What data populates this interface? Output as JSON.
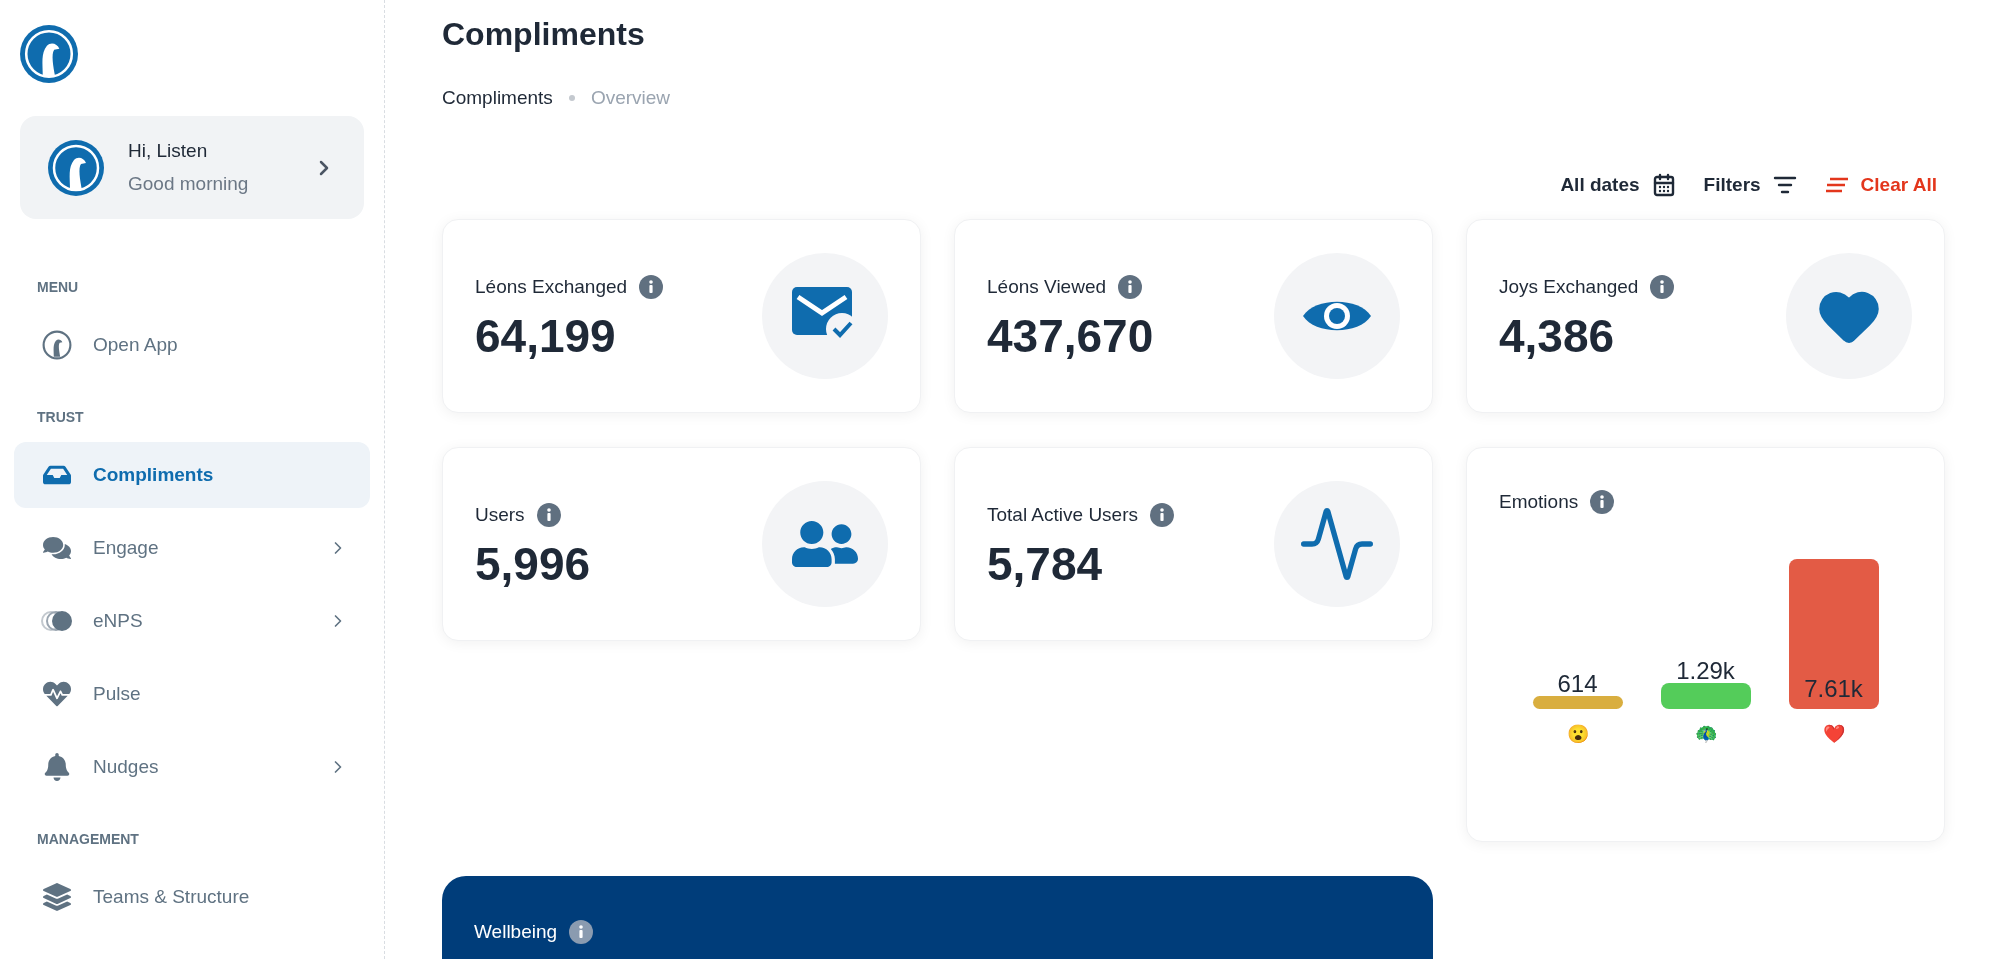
{
  "sidebar": {
    "profile": {
      "title": "Hi, Listen",
      "subtitle": "Good morning"
    },
    "sections": [
      {
        "heading": "MENU",
        "items": [
          {
            "label": "Open App",
            "kind": "bird",
            "selected": false,
            "expandable": false
          }
        ]
      },
      {
        "heading": "TRUST",
        "items": [
          {
            "label": "Compliments",
            "kind": "inbox",
            "selected": true,
            "expandable": false
          },
          {
            "label": "Engage",
            "kind": "chat",
            "selected": false,
            "expandable": true
          },
          {
            "label": "eNPS",
            "kind": "circles",
            "selected": false,
            "expandable": true
          },
          {
            "label": "Pulse",
            "kind": "heartbeat",
            "selected": false,
            "expandable": false
          },
          {
            "label": "Nudges",
            "kind": "bell",
            "selected": false,
            "expandable": true
          }
        ]
      },
      {
        "heading": "MANAGEMENT",
        "items": [
          {
            "label": "Teams & Structure",
            "kind": "layers",
            "selected": false,
            "expandable": false
          }
        ]
      }
    ]
  },
  "page": {
    "title": "Compliments",
    "breadcrumb": [
      {
        "label": "Compliments",
        "selected": true
      },
      {
        "label": "Overview",
        "selected": false
      }
    ]
  },
  "filters": [
    {
      "label": "All dates",
      "kind": "date"
    },
    {
      "label": "Filters",
      "kind": "filter"
    },
    {
      "label": "Clear All",
      "kind": "clear"
    }
  ],
  "stats": [
    {
      "label": "Léons Exchanged",
      "value": "64,199",
      "kind": "mail"
    },
    {
      "label": "Léons Viewed",
      "value": "437,670",
      "kind": "eye"
    },
    {
      "label": "Joys Exchanged",
      "value": "4,386",
      "kind": "heart"
    },
    {
      "label": "Users",
      "value": "5,996",
      "kind": "users"
    },
    {
      "label": "Total Active Users",
      "value": "5,784",
      "kind": "activity"
    }
  ],
  "emotions": {
    "title": "Emotions",
    "chart_data": {
      "type": "bar",
      "categories": [
        "😮",
        "🦚",
        "❤️"
      ],
      "values": [
        614,
        1290,
        7610
      ],
      "value_labels": [
        "614",
        "1.29k",
        "7.61k"
      ],
      "colors": [
        "#d9ae3f",
        "#54cc5a",
        "#e35b45"
      ]
    }
  },
  "wellbeing": {
    "title": "Wellbeing"
  }
}
